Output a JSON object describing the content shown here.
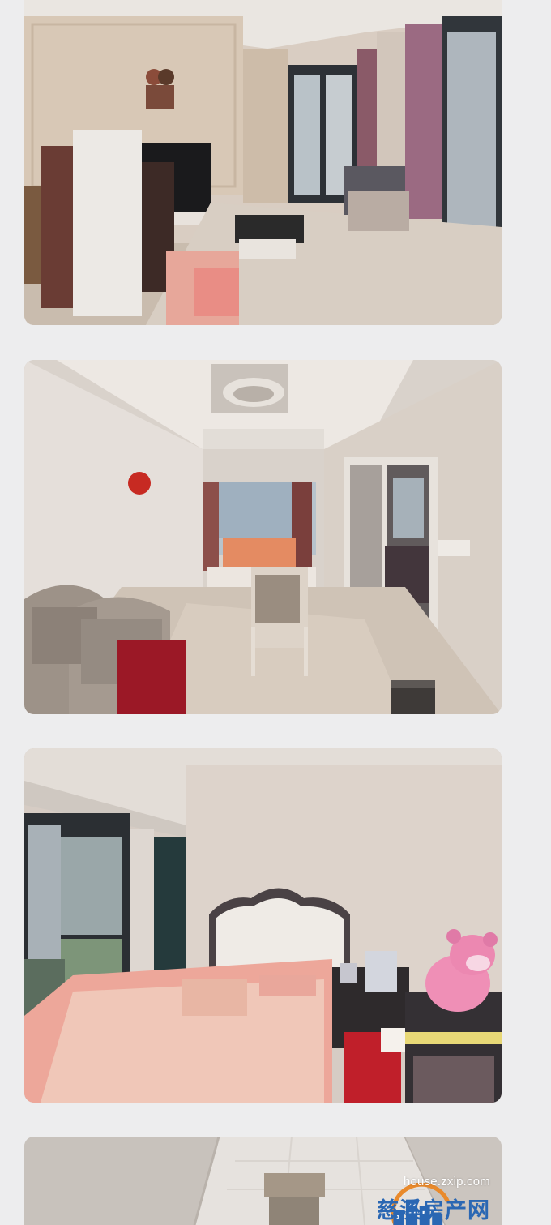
{
  "watermark": {
    "url": "house.zxip.com",
    "name": "慈溪房产网",
    "logo_icon": "city-buildings-icon",
    "colors": {
      "name": "#2a67b3",
      "logo_blue": "#2a67b3",
      "logo_orange": "#e98a2c"
    }
  }
}
